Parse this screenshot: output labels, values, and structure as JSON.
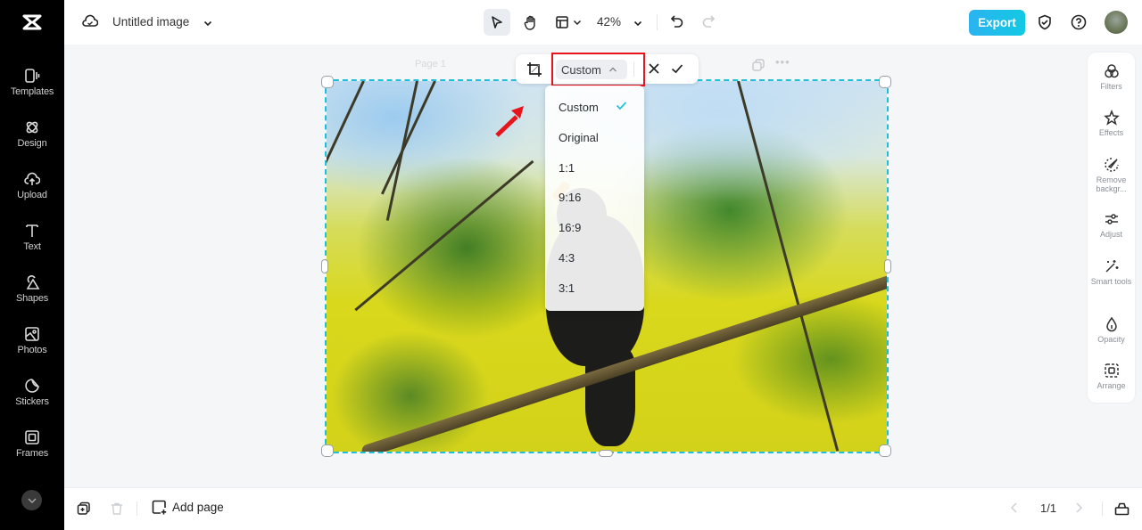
{
  "app": {
    "document_title": "Untitled image"
  },
  "sidebar": {
    "items": [
      {
        "label": "Templates",
        "icon": "templates-icon"
      },
      {
        "label": "Design",
        "icon": "design-icon"
      },
      {
        "label": "Upload",
        "icon": "upload-icon"
      },
      {
        "label": "Text",
        "icon": "text-icon"
      },
      {
        "label": "Shapes",
        "icon": "shapes-icon"
      },
      {
        "label": "Photos",
        "icon": "photos-icon"
      },
      {
        "label": "Stickers",
        "icon": "stickers-icon"
      },
      {
        "label": "Frames",
        "icon": "frames-icon"
      }
    ]
  },
  "toolbar": {
    "zoom_level": "42%",
    "export_label": "Export",
    "export_color": "#1ec0e6"
  },
  "canvas": {
    "page_label": "Page 1",
    "selection_color": "#1ec0d8"
  },
  "crop": {
    "selected_ratio": "Custom",
    "highlight_color": "#e8141c",
    "options": [
      {
        "label": "Custom",
        "selected": true
      },
      {
        "label": "Original",
        "selected": false
      },
      {
        "label": "1:1",
        "selected": false
      },
      {
        "label": "9:16",
        "selected": false
      },
      {
        "label": "16:9",
        "selected": false
      },
      {
        "label": "4:3",
        "selected": false
      },
      {
        "label": "3:1",
        "selected": false
      }
    ]
  },
  "right_panel": {
    "items": [
      {
        "label": "Filters",
        "icon": "filters-icon"
      },
      {
        "label": "Effects",
        "icon": "effects-icon"
      },
      {
        "label": "Remove backgr...",
        "icon": "remove-background-icon"
      },
      {
        "label": "Adjust",
        "icon": "adjust-icon"
      },
      {
        "label": "Smart tools",
        "icon": "smart-tools-icon"
      },
      {
        "label": "Opacity",
        "icon": "opacity-icon"
      },
      {
        "label": "Arrange",
        "icon": "arrange-icon"
      }
    ]
  },
  "bottombar": {
    "add_page_label": "Add page",
    "page_indicator": "1/1"
  }
}
